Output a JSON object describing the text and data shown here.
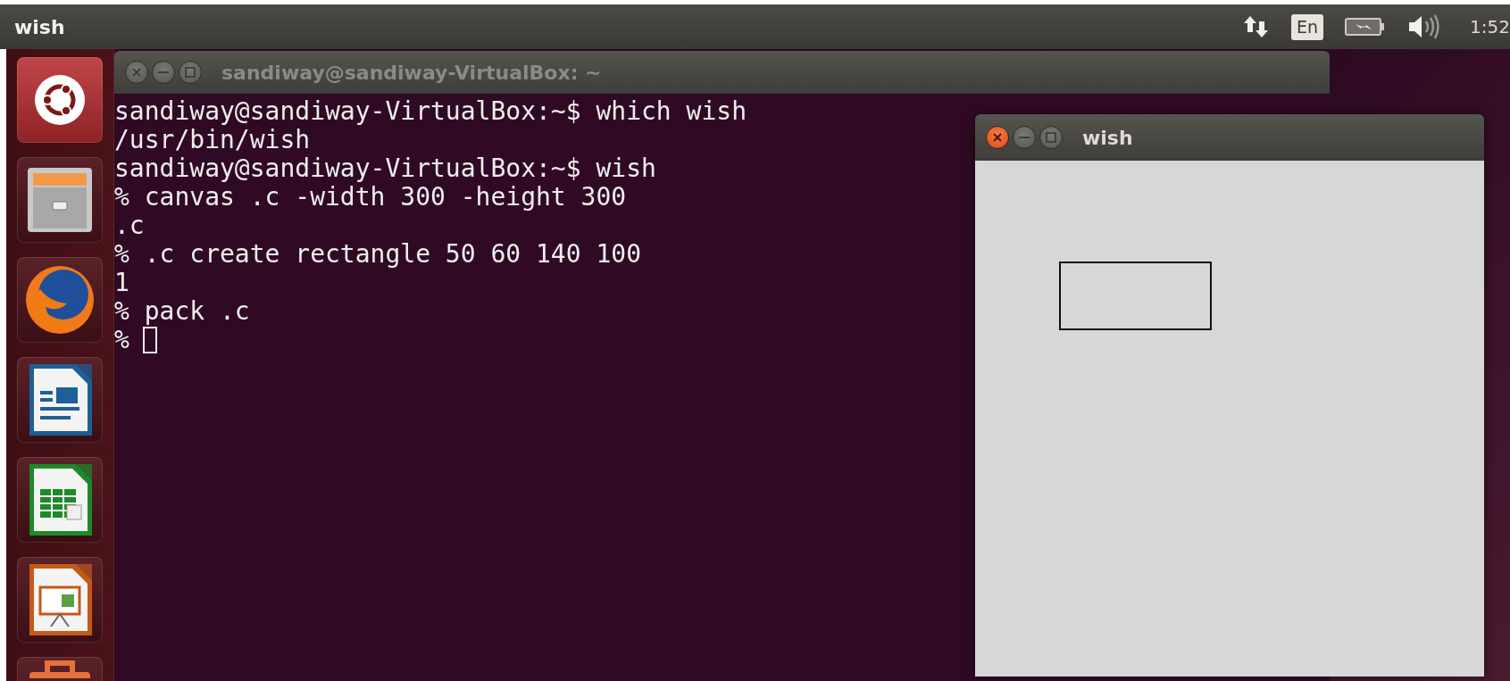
{
  "top_panel": {
    "app_title": "wish",
    "keyboard_layout": "En",
    "clock": "1:52"
  },
  "terminal_window": {
    "title": "sandiway@sandiway-VirtualBox: ~",
    "active": false,
    "lines": [
      "sandiway@sandiway-VirtualBox:~$ which wish",
      "/usr/bin/wish",
      "sandiway@sandiway-VirtualBox:~$ wish",
      "% canvas .c -width 300 -height 300",
      ".c",
      "% .c create rectangle 50 60 140 100",
      "1",
      "% pack .c"
    ],
    "prompt": "%"
  },
  "wish_window": {
    "title": "wish",
    "active": true
  }
}
